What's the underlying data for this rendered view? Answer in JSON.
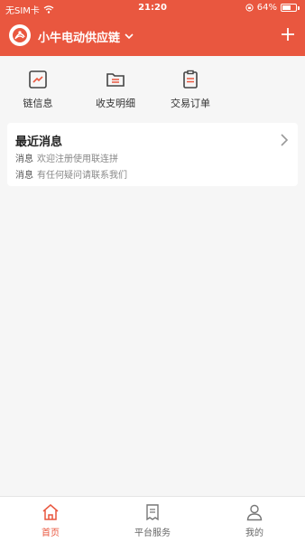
{
  "statusbar": {
    "carrier": "无SIM卡",
    "time": "21:20",
    "battery_percent_text": "64%",
    "battery_level": 0.64
  },
  "header": {
    "title": "小牛电动供应链",
    "title_icon": "chevron-down-icon",
    "add_icon": "plus-icon"
  },
  "quick_actions": [
    {
      "label": "链信息",
      "icon": "chart-icon"
    },
    {
      "label": "收支明细",
      "icon": "folder-list-icon"
    },
    {
      "label": "交易订单",
      "icon": "clipboard-icon"
    }
  ],
  "recent_messages": {
    "title": "最近消息",
    "items": [
      {
        "tag": "消息",
        "text": "欢迎注册使用联连拼"
      },
      {
        "tag": "消息",
        "text": "有任何疑问请联系我们"
      }
    ]
  },
  "tabbar": {
    "tabs": [
      {
        "label": "首页",
        "icon": "home-icon",
        "active": true
      },
      {
        "label": "平台服务",
        "icon": "document-icon",
        "active": false
      },
      {
        "label": "我的",
        "icon": "user-icon",
        "active": false
      }
    ]
  },
  "colors": {
    "brand": "#e9573f",
    "background": "#f6f6f6",
    "card": "#ffffff"
  }
}
